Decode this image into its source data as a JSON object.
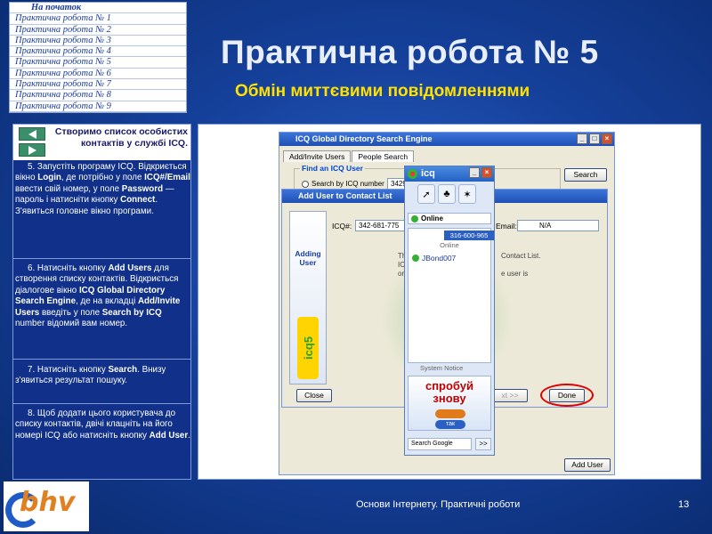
{
  "nav": {
    "items": [
      "На початок",
      "Практична робота № 1",
      "Практична робота № 2",
      "Практична робота № 3",
      "Практична робота № 4",
      "Практична робота № 5",
      "Практична робота № 6",
      "Практична робота № 7",
      "Практична робота № 8",
      "Практична робота № 9"
    ]
  },
  "slide": {
    "title": "Практична робота № 5",
    "subtitle": "Обмін миттєвими повідомленнями",
    "footer": "Основи Інтернету. Практичні роботи",
    "page_number": "13",
    "logo_text": "bhv"
  },
  "panel": {
    "heading": "Створимо список особистих контактів у службі ICQ.",
    "steps": [
      {
        "n": "5.",
        "parts": [
          "Запустіть програму ICQ. Відкриється вікно ",
          "Login",
          ", де потрібно у поле ",
          "ICQ#/Email",
          " ввести свій номер, у поле ",
          "Password",
          " — пароль і натисніти кнопку ",
          "Connect",
          ". З'явиться головне вікно програми."
        ]
      },
      {
        "n": "6.",
        "parts": [
          "Натисніть кнопку ",
          "Add Users",
          " для створення списку контактів. Відкриється діалогове вікно ",
          "ICQ Global Directory Search Engine",
          ", де на вкладці ",
          "Add/Invite Users",
          " введіть у поле ",
          "Search by ICQ",
          " number відомий вам номер."
        ]
      },
      {
        "n": "7.",
        "parts": [
          "Натисніть кнопку ",
          "Search",
          ". Внизу з'явиться результат пошуку."
        ]
      },
      {
        "n": "8.",
        "parts": [
          "Щоб додати цього користувача до списку контактів, двічі клацніть на його номері ICQ або натисніть кнопку ",
          "Add User",
          "."
        ]
      }
    ]
  },
  "dir_window": {
    "title": "ICQ Global Directory Search Engine",
    "tabs": [
      "Add/Invite Users",
      "People Search"
    ],
    "group_label": "Find an ICQ User",
    "radio_label": "Search by ICQ number",
    "input_value": "3429",
    "search_button": "Search",
    "add_user_button": "Add User"
  },
  "add_window": {
    "title": "Add User to Contact List",
    "sidebar_label": "Adding User",
    "logo_text": "icq5",
    "icq_label": "ICQ#:",
    "icq_value": "342-681-775",
    "email_label": "Email:",
    "email_value": "N/A",
    "info_lines": [
      "Th",
      "ICQ",
      "or"
    ],
    "info_right": [
      "Contact List.",
      "e user is"
    ],
    "close_button": "Close",
    "next_button": "xt >>",
    "done_button": "Done"
  },
  "icq_window": {
    "title": "icq",
    "status": "Online",
    "number": "316-600-965",
    "online_header": "Online",
    "contact": "JBond007",
    "system_notice": "System Notice",
    "ad_text": "спробуй знову",
    "ad_button": "так",
    "search_placeholder": "Search Google",
    "search_go": ">>"
  }
}
